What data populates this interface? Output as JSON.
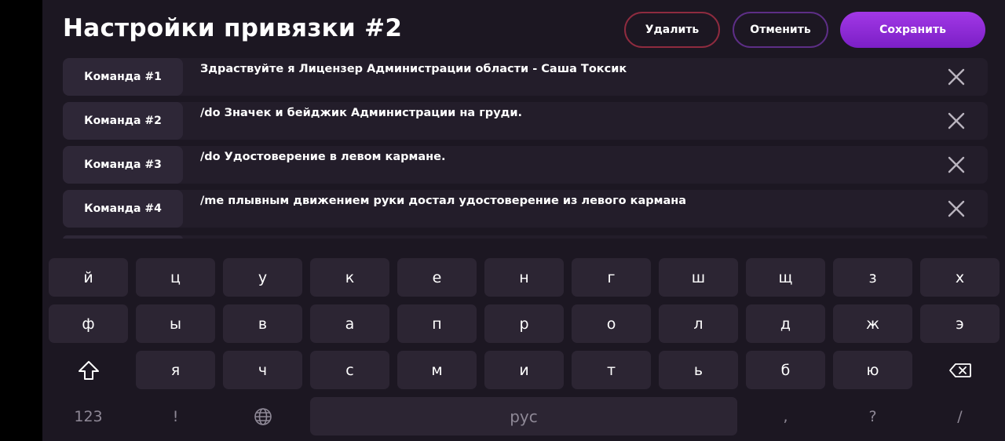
{
  "header": {
    "title": "Настройки привязки #2",
    "delete_label": "Удалить",
    "cancel_label": "Отменить",
    "save_label": "Сохранить"
  },
  "commands": [
    {
      "label": "Команда #1",
      "text": "Здраствуйте я Лицензер Администрации области - Саша Токсик"
    },
    {
      "label": "Команда #2",
      "text": "/do Значек и бейджик Администрации на груди."
    },
    {
      "label": "Команда #3",
      "text": "/do Удостоверение в левом кармане."
    },
    {
      "label": "Команда #4",
      "text": "/me плывным движением руки достал удостоверение из левого кармана"
    }
  ],
  "keyboard": {
    "row1": [
      "й",
      "ц",
      "у",
      "к",
      "е",
      "н",
      "г",
      "ш",
      "щ",
      "з",
      "х"
    ],
    "row2": [
      "ф",
      "ы",
      "в",
      "а",
      "п",
      "р",
      "о",
      "л",
      "д",
      "ж",
      "э"
    ],
    "row3": [
      "я",
      "ч",
      "с",
      "м",
      "и",
      "т",
      "ь",
      "б",
      "ю"
    ],
    "numbers_label": "123",
    "exclaim_label": "!",
    "space_label": "рус",
    "comma_label": ",",
    "question_label": "?",
    "slash_label": "/",
    "icons": {
      "shift": "shift-icon",
      "backspace": "backspace-icon",
      "language": "globe-icon",
      "close": "close-icon"
    }
  },
  "colors": {
    "background": "#1c1722",
    "key": "#2c2533",
    "save_accent": "#9a30e0",
    "delete_border": "#8e2b3f",
    "cancel_border": "#5d2e86"
  }
}
